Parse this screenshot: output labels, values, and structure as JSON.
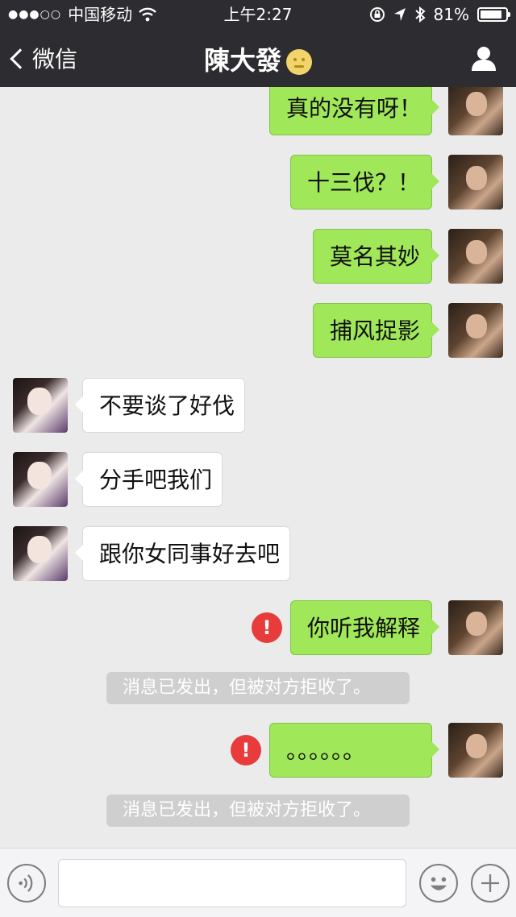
{
  "status_bar": {
    "signal_dots": "●●●○○",
    "carrier": "中国移动",
    "time": "上午2:27",
    "battery_percent": "81%",
    "battery_level": 0.81
  },
  "nav": {
    "back_label": "微信",
    "title": "陳大發"
  },
  "messages": [
    {
      "type": "out",
      "text": "真的没有呀！"
    },
    {
      "type": "out",
      "text": "十三伐？！"
    },
    {
      "type": "out",
      "text": "莫名其妙"
    },
    {
      "type": "out",
      "text": "捕风捉影"
    },
    {
      "type": "in",
      "text": "不要谈了好伐"
    },
    {
      "type": "in",
      "text": "分手吧我们"
    },
    {
      "type": "in",
      "text": "跟你女同事好去吧"
    },
    {
      "type": "out",
      "text": "你听我解释",
      "failed": true
    },
    {
      "type": "system",
      "text": "消息已发出，但被对方拒收了。"
    },
    {
      "type": "out",
      "text": "。。。。。。",
      "failed": true
    },
    {
      "type": "system",
      "text": "消息已发出，但被对方拒收了。"
    }
  ],
  "error_mark": "!",
  "colors": {
    "nav_bg": "#2d2d31",
    "chat_bg": "#ebebeb",
    "outgoing_bubble": "#a0e75a",
    "incoming_bubble": "#ffffff",
    "error_red": "#e83b3b"
  },
  "icons": {
    "wifi": "wifi-icon",
    "lock_rotation": "lock-rotation-icon",
    "location": "location-arrow-icon",
    "bluetooth": "bluetooth-icon",
    "battery": "battery-icon",
    "back": "chevron-left-icon",
    "profile": "person-icon",
    "voice": "voice-icon",
    "emoji": "smiley-icon",
    "plus": "plus-icon"
  }
}
